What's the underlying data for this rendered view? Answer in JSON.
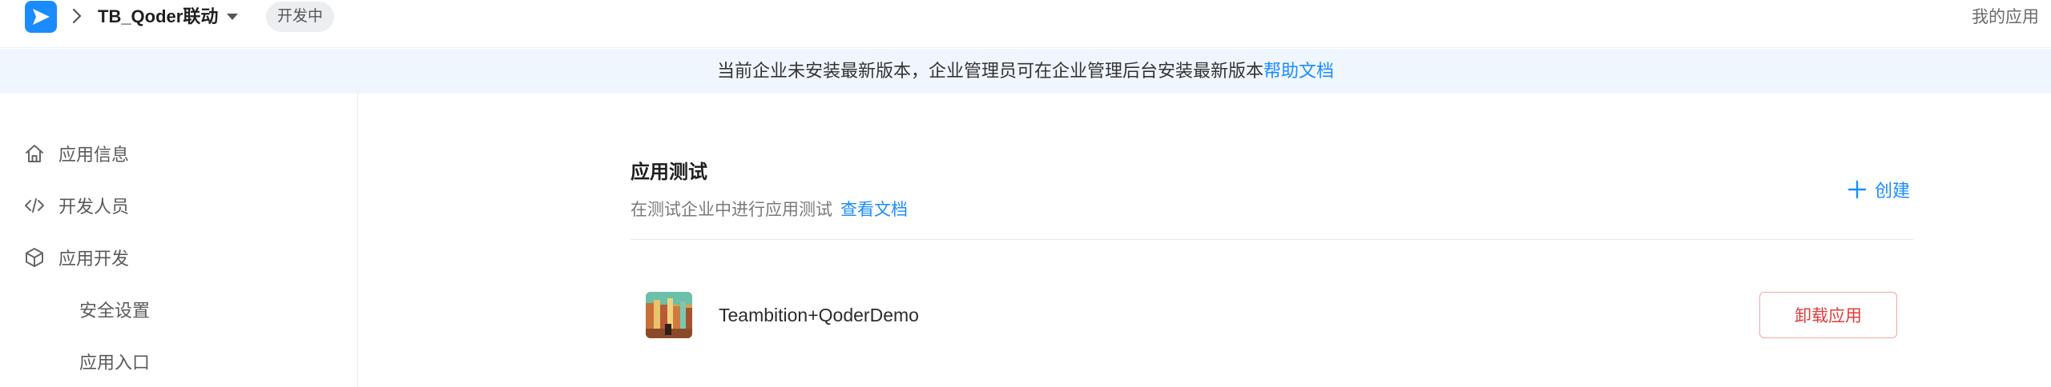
{
  "header": {
    "app_name": "TB_Qoder联动",
    "status_badge": "开发中",
    "my_apps_link": "我的应用"
  },
  "notice": {
    "text": "当前企业未安装最新版本，企业管理员可在企业管理后台安装最新版本",
    "link": "帮助文档"
  },
  "sidebar": {
    "items": [
      {
        "label": "应用信息",
        "icon": "home-icon"
      },
      {
        "label": "开发人员",
        "icon": "code-icon"
      },
      {
        "label": "应用开发",
        "icon": "cube-icon"
      },
      {
        "label": "安全设置",
        "icon": ""
      },
      {
        "label": "应用入口",
        "icon": ""
      }
    ]
  },
  "main": {
    "title": "应用测试",
    "description": "在测试企业中进行应用测试",
    "doc_link": "查看文档",
    "create_label": "创建",
    "apps": [
      {
        "name": "Teambition+QoderDemo",
        "action": "卸载应用"
      }
    ]
  },
  "colors": {
    "accent": "#1a8cff",
    "danger": "#e23b3b",
    "notice_bg": "#f0f6fd"
  }
}
